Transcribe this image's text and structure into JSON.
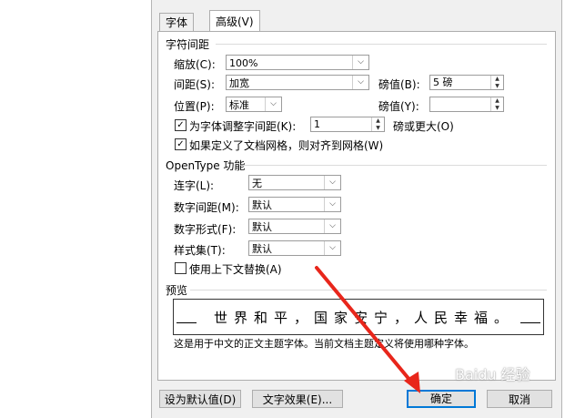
{
  "tabs": [
    "字体",
    "高级(V)"
  ],
  "spacing": {
    "title": "字符间距",
    "scale_label": "缩放(C):",
    "scale_value": "100%",
    "spacing_label": "间距(S):",
    "spacing_value": "加宽",
    "spacing_by_label": "磅值(B):",
    "spacing_by_value": "5 磅",
    "position_label": "位置(P):",
    "position_value": "标准",
    "position_by_label": "磅值(Y):",
    "position_by_value": "",
    "kerning_label": "为字体调整字间距(K):",
    "kerning_value": "1",
    "kerning_unit": "磅或更大(O)",
    "kerning_checked": true,
    "grid_label": "如果定义了文档网格，则对齐到网格(W)",
    "grid_checked": true
  },
  "opentype": {
    "title": "OpenType 功能",
    "ligatures_label": "连字(L):",
    "ligatures_value": "无",
    "num_spacing_label": "数字间距(M):",
    "num_spacing_value": "默认",
    "num_forms_label": "数字形式(F):",
    "num_forms_value": "默认",
    "stylistic_label": "样式集(T):",
    "stylistic_value": "默认",
    "contextual_label": "使用上下文替换(A)",
    "contextual_checked": false
  },
  "preview": {
    "title": "预览",
    "text": "世界和平，国家安宁，人民幸福。",
    "note": "这是用于中文的正文主题字体。当前文档主题定义将使用哪种字体。"
  },
  "buttons": {
    "set_default": "设为默认值(D)",
    "text_effects": "文字效果(E)...",
    "ok": "确定",
    "cancel": "取消"
  },
  "watermark": "Baidu 经验",
  "colors": {
    "arrow": "#e8261b",
    "focus": "#0078d7"
  }
}
